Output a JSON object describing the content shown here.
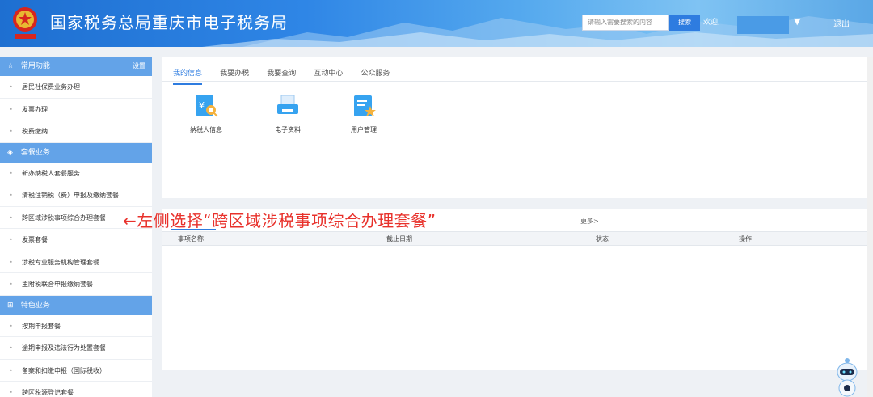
{
  "header": {
    "site_title": "国家税务总局重庆市电子税务局",
    "search_placeholder": "请输入需要搜索的内容",
    "search_button": "搜索",
    "welcome": "欢迎,",
    "user_dropdown": "▼",
    "logout": "退出"
  },
  "sidebar": {
    "sections": [
      {
        "title": "常用功能",
        "icon": "star-icon",
        "settings": "设置",
        "items": [
          "居民社保费业务办理",
          "发票办理",
          "税费缴纳"
        ]
      },
      {
        "title": "套餐业务",
        "icon": "layers-icon",
        "items": [
          "新办纳税人套餐服务",
          "清税注销税（费）申报及缴纳套餐",
          "跨区域涉税事项综合办理套餐",
          "发票套餐",
          "涉税专业服务机构管理套餐",
          "主附税联合申报缴纳套餐"
        ]
      },
      {
        "title": "特色业务",
        "icon": "grid-icon",
        "items": [
          "按期申报套餐",
          "逾期申报及违法行为处置套餐",
          "备案和扣缴申报（国际税收）",
          "跨区税源登记套餐"
        ]
      }
    ]
  },
  "annotation": "←左侧选择“跨区域涉税事项综合办理套餐”",
  "top_panel": {
    "tabs": [
      "我的信息",
      "我要办税",
      "我要查询",
      "互动中心",
      "公众服务"
    ],
    "active_tab": 0,
    "functions": [
      {
        "label": "纳税人信息",
        "icon": "taxpayer-info-icon"
      },
      {
        "label": "电子资料",
        "icon": "electronic-data-icon"
      },
      {
        "label": "用户管理",
        "icon": "user-management-icon"
      }
    ]
  },
  "bottom_panel": {
    "more": "更多>",
    "columns": [
      "事项名称",
      "截止日期",
      "状态",
      "操作"
    ]
  },
  "colors": {
    "primary": "#2e7ce0",
    "section_bg": "#63a3e8",
    "annotation": "#e8312b"
  }
}
